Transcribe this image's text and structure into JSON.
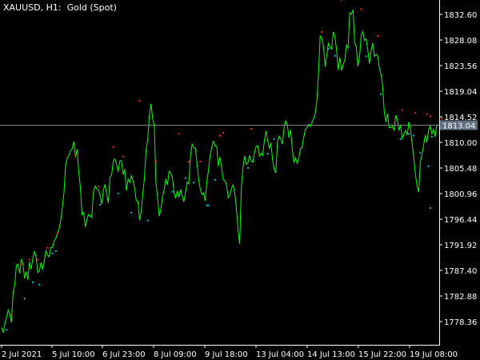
{
  "header": {
    "symbol": "XAUUSD, H1:",
    "name": "Gold (Spot)"
  },
  "colors": {
    "background": "#000000",
    "price_line": "#00ff00",
    "upper_dots": "#ff2020",
    "lower_dots": "#00c0d0",
    "axis": "#ffffff",
    "current_line": "#808080"
  },
  "current_price": "1813.04",
  "chart_data": {
    "type": "line",
    "y_ticks": [
      "1832.60",
      "1828.08",
      "1823.56",
      "1819.04",
      "1814.52",
      "1810.00",
      "1805.48",
      "1800.96",
      "1796.44",
      "1791.92",
      "1787.40",
      "1782.88",
      "1778.36"
    ],
    "x_ticks": [
      "2 Jul 2021",
      "5 Jul 10:00",
      "6 Jul 23:00",
      "8 Jul 09:00",
      "9 Jul 18:00",
      "13 Jul 04:00",
      "14 Jul 13:00",
      "15 Jul 22:00",
      "19 Jul 08:00"
    ],
    "ylim": [
      1774.5,
      1836.2
    ],
    "series": [
      {
        "values": [
          1777.3,
          1776.4,
          1778.0,
          1779.1,
          1780.4,
          1779.6,
          1778.2,
          1783.5,
          1784.8,
          1788.3,
          1788.5,
          1786.9,
          1789.4,
          1788.6,
          1786.0,
          1787.2,
          1785.8,
          1788.9,
          1787.6,
          1789.5,
          1790.8,
          1789.8,
          1787.0,
          1787.3,
          1788.8,
          1787.5,
          1789.1,
          1790.9,
          1790.1,
          1789.8,
          1791.5,
          1791.4,
          1792.6,
          1793.0,
          1794.0,
          1794.7,
          1796.2,
          1798.5,
          1801.2,
          1806.1,
          1807.2,
          1807.8,
          1808.5,
          1808.9,
          1810.1,
          1807.4,
          1808.8,
          1804.7,
          1802.0,
          1797.2,
          1797.6,
          1795.1,
          1796.5,
          1797.3,
          1796.9,
          1797.2,
          1801.4,
          1802.3,
          1801.8,
          1801.6,
          1800.6,
          1799.1,
          1801.6,
          1802.6,
          1800.8,
          1799.3,
          1803.9,
          1804.2,
          1806.7,
          1807.1,
          1806.1,
          1804.8,
          1806.7,
          1806.8,
          1804.3,
          1805.3,
          1801.5,
          1803.5,
          1802.9,
          1804.1,
          1803.3,
          1801.9,
          1799.7,
          1799.6,
          1796.3,
          1797.8,
          1800.9,
          1803.8,
          1808.7,
          1810.6,
          1814.7,
          1816.8,
          1814.2,
          1812.9,
          1803.0,
          1800.2,
          1797.0,
          1798.2,
          1800.5,
          1801.6,
          1803.6,
          1802.5,
          1804.9,
          1804.6,
          1803.8,
          1801.2,
          1800.1,
          1801.5,
          1800.3,
          1801.7,
          1800.5,
          1799.5,
          1801.2,
          1803.0,
          1802.7,
          1807.6,
          1809.7,
          1809.0,
          1809.0,
          1806.3,
          1803.5,
          1801.7,
          1800.8,
          1801.1,
          1799.7,
          1803.1,
          1805.1,
          1807.7,
          1809.2,
          1810.2,
          1809.4,
          1809.3,
          1805.8,
          1807.4,
          1805.5,
          1803.4,
          1803.2,
          1802.5,
          1800.2,
          1800.7,
          1801.9,
          1802.5,
          1801.0,
          1798.3,
          1794.5,
          1792.1,
          1802.1,
          1805.6,
          1807.6,
          1806.1,
          1806.4,
          1807.7,
          1806.7,
          1806.5,
          1808.2,
          1809.3,
          1809.4,
          1807.6,
          1808.1,
          1807.7,
          1810.3,
          1812.0,
          1810.4,
          1809.0,
          1809.9,
          1807.0,
          1805.3,
          1804.6,
          1810.0,
          1811.1,
          1810.6,
          1809.7,
          1812.7,
          1813.8,
          1813.1,
          1810.8,
          1812.2,
          1808.9,
          1806.4,
          1807.3,
          1806.3,
          1807.2,
          1808.9,
          1809.1,
          1810.9,
          1812.3,
          1812.6,
          1813.2,
          1812.8,
          1813.5,
          1814.2,
          1815.1,
          1817.4,
          1822.3,
          1828.8,
          1828.4,
          1827.0,
          1823.4,
          1825.3,
          1827.6,
          1826.8,
          1826.5,
          1829.5,
          1828.7,
          1826.3,
          1822.8,
          1825.0,
          1822.7,
          1823.7,
          1824.5,
          1827.2,
          1826.7,
          1832.9,
          1832.6,
          1833.4,
          1827.5,
          1826.9,
          1823.4,
          1825.2,
          1828.9,
          1829.6,
          1828.0,
          1828.3,
          1826.4,
          1823.9,
          1826.1,
          1827.6,
          1825.2,
          1825.6,
          1825.3,
          1823.2,
          1822.1,
          1820.2,
          1815.4,
          1813.6,
          1815.1,
          1812.6,
          1812.6,
          1812.9,
          1812.1,
          1814.8,
          1814.1,
          1812.2,
          1813.0,
          1810.7,
          1811.4,
          1812.1,
          1811.3,
          1813.6,
          1812.5,
          1809.6,
          1807.4,
          1804.3,
          1802.3,
          1801.2,
          1806.5,
          1807.8,
          1809.5,
          1811.3,
          1810.0,
          1812.2,
          1812.9,
          1811.5,
          1812.3,
          1811.0,
          1813.0,
          1813.04
        ]
      }
    ],
    "upper_dots": [
      [
        6,
        1779.6
      ],
      [
        12,
        1788.5
      ],
      [
        17,
        1789.3
      ],
      [
        22,
        1789.3
      ],
      [
        28,
        1791.4
      ],
      [
        34,
        1794.0
      ],
      [
        45,
        1807.7
      ],
      [
        59,
        1802.2
      ],
      [
        68,
        1809.2
      ],
      [
        74,
        1807.5
      ],
      [
        84,
        1817.3
      ],
      [
        94,
        1806.6
      ],
      [
        108,
        1811.5
      ],
      [
        114,
        1806.6
      ],
      [
        121,
        1806.6
      ],
      [
        133,
        1811.2
      ],
      [
        135,
        1811.7
      ],
      [
        152,
        1812.4
      ],
      [
        195,
        1829.5
      ],
      [
        207,
        1835.2
      ],
      [
        219,
        1833.5
      ],
      [
        229,
        1828.8
      ],
      [
        244,
        1815.7
      ],
      [
        252,
        1815.2
      ],
      [
        259,
        1815.0
      ],
      [
        261,
        1814.6
      ],
      [
        268,
        1814.2
      ]
    ],
    "lower_dots": [
      [
        3,
        1776.9
      ],
      [
        14,
        1782.4
      ],
      [
        19,
        1785.3
      ],
      [
        23,
        1784.9
      ],
      [
        31,
        1790.4
      ],
      [
        33,
        1790.8
      ],
      [
        55,
        1796.8
      ],
      [
        60,
        1799.0
      ],
      [
        71,
        1801.0
      ],
      [
        79,
        1797.6
      ],
      [
        89,
        1796.2
      ],
      [
        104,
        1801.3
      ],
      [
        112,
        1803.7
      ],
      [
        117,
        1802.9
      ],
      [
        125,
        1798.9
      ],
      [
        126,
        1798.9
      ],
      [
        130,
        1803.4
      ],
      [
        150,
        1805.5
      ],
      [
        162,
        1808.0
      ],
      [
        166,
        1810.6
      ],
      [
        199,
        1826.5
      ],
      [
        203,
        1825.3
      ],
      [
        222,
        1825.2
      ],
      [
        231,
        1818.5
      ],
      [
        243,
        1810.6
      ],
      [
        248,
        1811.5
      ],
      [
        251,
        1811.2
      ],
      [
        255,
        1808.2
      ],
      [
        260,
        1805.8
      ],
      [
        261,
        1798.4
      ],
      [
        262,
        1811.0
      ]
    ]
  }
}
